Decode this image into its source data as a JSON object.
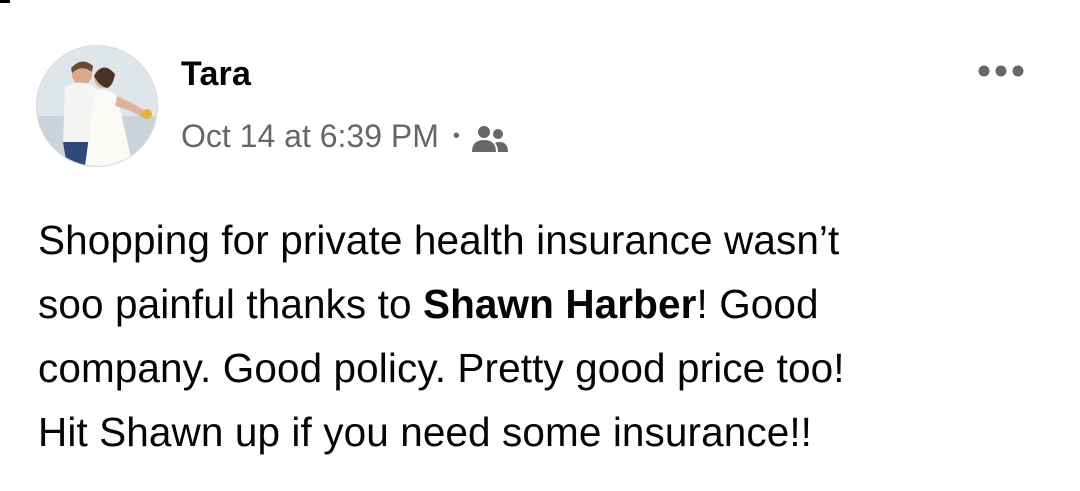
{
  "post": {
    "author": "Tara",
    "timestamp": "Oct 14 at 6:39 PM",
    "separator": "•",
    "audience_icon": "friends-icon",
    "more_icon": "more-options-icon",
    "text": {
      "line1": "Shopping for private health insurance wasn’t",
      "line2_before": "soo painful thanks to ",
      "mention": "Shawn Harber",
      "line2_after": "! Good",
      "line3": "company. Good policy. Pretty good price too!",
      "line4": "Hit Shawn up if you need some insurance!!"
    }
  },
  "colors": {
    "primary_text": "#050505",
    "secondary_text": "#65676b",
    "background": "#ffffff"
  }
}
